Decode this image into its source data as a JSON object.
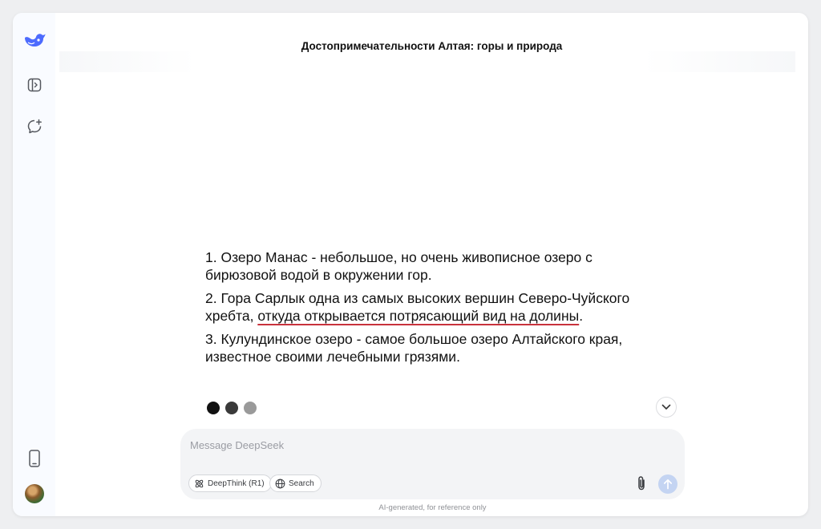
{
  "header": {
    "title": "Достопримечательности Алтая: горы и природа"
  },
  "sidebar": {
    "logo_icon": "deepseek-whale-icon",
    "items": [
      {
        "name": "toggle-sidebar-icon"
      },
      {
        "name": "new-chat-icon"
      },
      {
        "name": "mobile-app-icon"
      },
      {
        "name": "user-avatar"
      }
    ]
  },
  "message": {
    "paragraphs": [
      {
        "text": "1. Озеро Манас - небольшое, но очень живописное озеро с бирюзовой водой в окружении гор."
      },
      {
        "before": "2. Гора Сарлык одна из самых высоких вершин Северо-Чуйского хребта, ",
        "underlined": "откуда открывается потрясающий вид на долины",
        "after": "."
      },
      {
        "text": "3. Кулундинское озеро - самое большое озеро Алтайского края, известное своими лечебными грязями."
      }
    ],
    "loading_dot_colors": [
      "#111111",
      "#3a3a3a",
      "#9a9a9a"
    ]
  },
  "composer": {
    "placeholder": "Message DeepSeek",
    "value": "",
    "deepthink_label": "DeepThink (R1)",
    "search_label": "Search"
  },
  "footer": {
    "disclaimer": "AI-generated, for reference only"
  },
  "colors": {
    "accent": "#4d6bfe",
    "underline": "#c8323c",
    "send_disabled": "#c4d4f2"
  }
}
